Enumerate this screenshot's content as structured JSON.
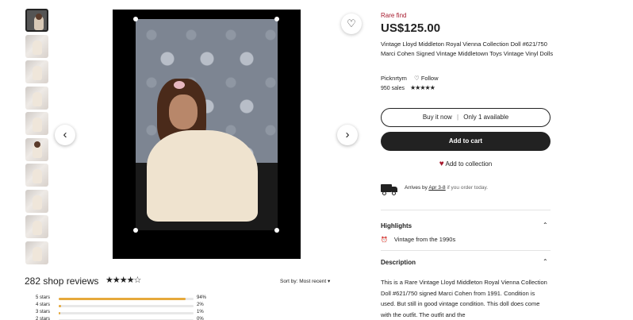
{
  "thumbnails": [
    {
      "name": "thumb-1",
      "fill": 0.0
    },
    {
      "name": "thumb-2"
    },
    {
      "name": "thumb-3"
    },
    {
      "name": "thumb-4"
    },
    {
      "name": "thumb-5"
    },
    {
      "name": "thumb-6"
    },
    {
      "name": "thumb-7"
    },
    {
      "name": "thumb-8"
    },
    {
      "name": "thumb-9"
    },
    {
      "name": "thumb-10"
    }
  ],
  "gallery": {
    "prev_icon": "‹",
    "next_icon": "›",
    "fav_icon": "♡"
  },
  "listing": {
    "badge": "Rare find",
    "price": "US$125.00",
    "title": "Vintage Lloyd Middleton Royal Vienna Collection Doll #621/750 Marci Cohen Signed Vintage Middletown Toys Vintage Vinyl Dolls",
    "shop": "Picknrtym",
    "follow": "Follow",
    "follow_icon": "♡",
    "sales": "950 sales",
    "shop_stars": "★★★★★",
    "buy_now": "Buy it now",
    "only": "Only 1 available",
    "add_to_cart": "Add to cart",
    "add_collection": "Add to collection",
    "collection_icon": "♥",
    "arrives_prefix": "Arrives by",
    "arrives_date": "Apr 3-8",
    "arrives_suffix": "if you order today."
  },
  "highlights": {
    "heading": "Highlights",
    "item": "Vintage from the 1990s",
    "item_icon": "⏰"
  },
  "description": {
    "heading": "Description",
    "text": "This is a Rare Vintage Lloyd Middleton Royal Vienna Collection Doll #621/750 signed Marci Cohen from 1991. Condition is used. But still in good vintage condition. This doll does come with the outfit. The outfit and the"
  },
  "reviews": {
    "count_label": "282 shop reviews",
    "stars": "★★★★☆",
    "sort_label": "Sort by: Most recent",
    "sort_icon": "▾",
    "rows": [
      {
        "label": "5 stars",
        "pct_text": "94%",
        "pct": 94
      },
      {
        "label": "4 stars",
        "pct_text": "2%",
        "pct": 2
      },
      {
        "label": "3 stars",
        "pct_text": "1%",
        "pct": 1
      },
      {
        "label": "2 stars",
        "pct_text": "0%",
        "pct": 0
      }
    ]
  },
  "colors": {
    "accent": "#a61a2e",
    "bar": "#e6a93b",
    "button": "#222222"
  }
}
